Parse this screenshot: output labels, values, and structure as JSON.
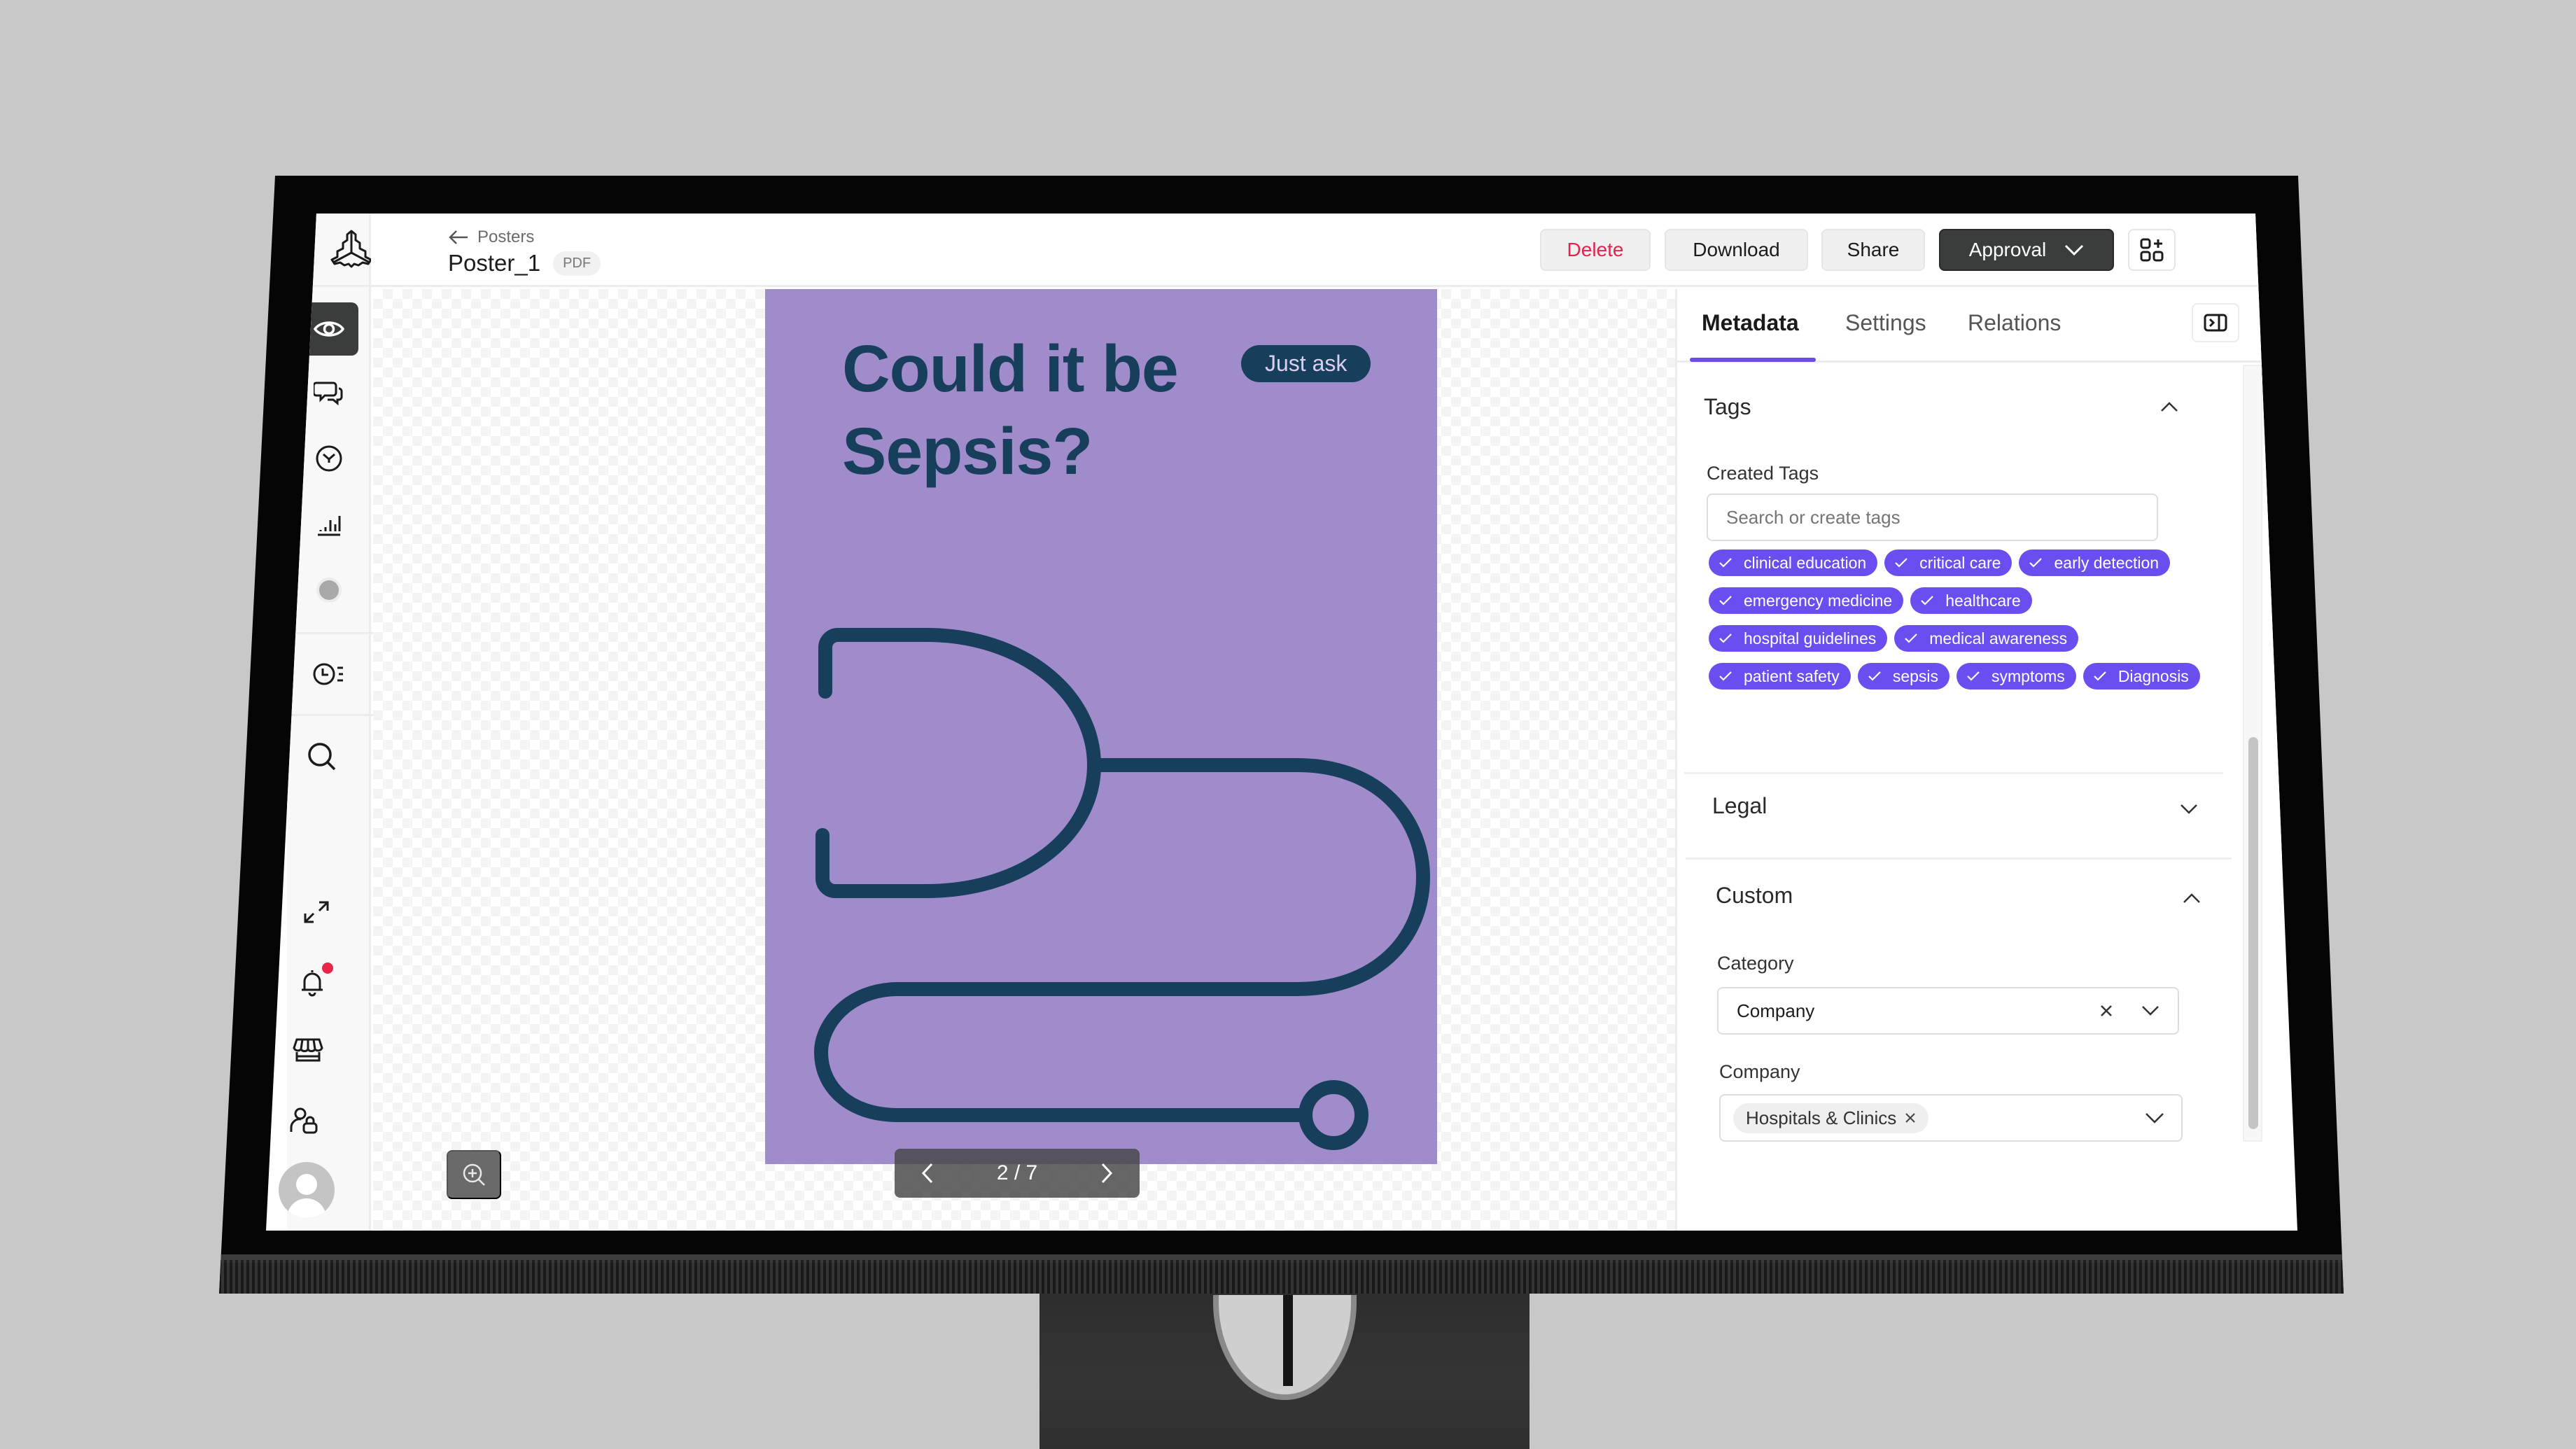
{
  "app": {
    "sidebar": {
      "logo": "tri-fold-logo-icon",
      "items": [
        {
          "id": "preview",
          "icon": "eye-icon",
          "active": true
        },
        {
          "id": "comments",
          "icon": "chat-bubbles-icon",
          "active": false
        },
        {
          "id": "versions",
          "icon": "clock-check-icon",
          "active": false
        },
        {
          "id": "analytics",
          "icon": "bar-chart-icon",
          "active": false
        },
        {
          "id": "status",
          "icon": "status-dot-icon",
          "active": false
        },
        {
          "id": "history",
          "icon": "timeline-clock-icon",
          "active": false
        },
        {
          "id": "search",
          "icon": "search-icon",
          "active": false
        }
      ],
      "bottom_items": [
        {
          "id": "fullscreen",
          "icon": "expand-icon"
        },
        {
          "id": "notifications",
          "icon": "bell-icon",
          "has_badge": true
        },
        {
          "id": "store",
          "icon": "storefront-icon"
        },
        {
          "id": "user-access",
          "icon": "user-lock-icon"
        }
      ],
      "avatar": "avatar-placeholder-icon"
    },
    "header": {
      "back_label": "Posters",
      "title": "Poster_1",
      "file_type": "PDF",
      "buttons": {
        "delete": "Delete",
        "download": "Download",
        "share": "Share",
        "approval": "Approval"
      }
    },
    "viewer": {
      "poster": {
        "headline_line1": "Could it be",
        "headline_line2": "Sepsis?",
        "pill": "Just ask",
        "background_color": "#a08bcb",
        "ink_color": "#173f5b"
      },
      "pagination": {
        "current": 2,
        "total": 7,
        "label": "2 / 7"
      }
    },
    "panel": {
      "tabs": [
        {
          "label": "Metadata",
          "active": true
        },
        {
          "label": "Settings",
          "active": false
        },
        {
          "label": "Relations",
          "active": false
        }
      ],
      "tags_section": {
        "title": "Tags",
        "expanded": true,
        "created_tags_label": "Created Tags",
        "search_placeholder": "Search or create tags",
        "tags": [
          "clinical education",
          "critical care",
          "early detection",
          "emergency medicine",
          "healthcare",
          "hospital guidelines",
          "medical awareness",
          "patient safety",
          "sepsis",
          "symptoms",
          "Diagnosis"
        ]
      },
      "legal_section": {
        "title": "Legal",
        "expanded": false
      },
      "custom_section": {
        "title": "Custom",
        "expanded": true,
        "category_label": "Category",
        "category_value": "Company",
        "company_label": "Company",
        "company_values": [
          "Hospitals & Clinics"
        ]
      }
    },
    "colors": {
      "accent": "#6c4ef0",
      "danger": "#e0264c",
      "dark_button": "#3b3d3d"
    }
  }
}
